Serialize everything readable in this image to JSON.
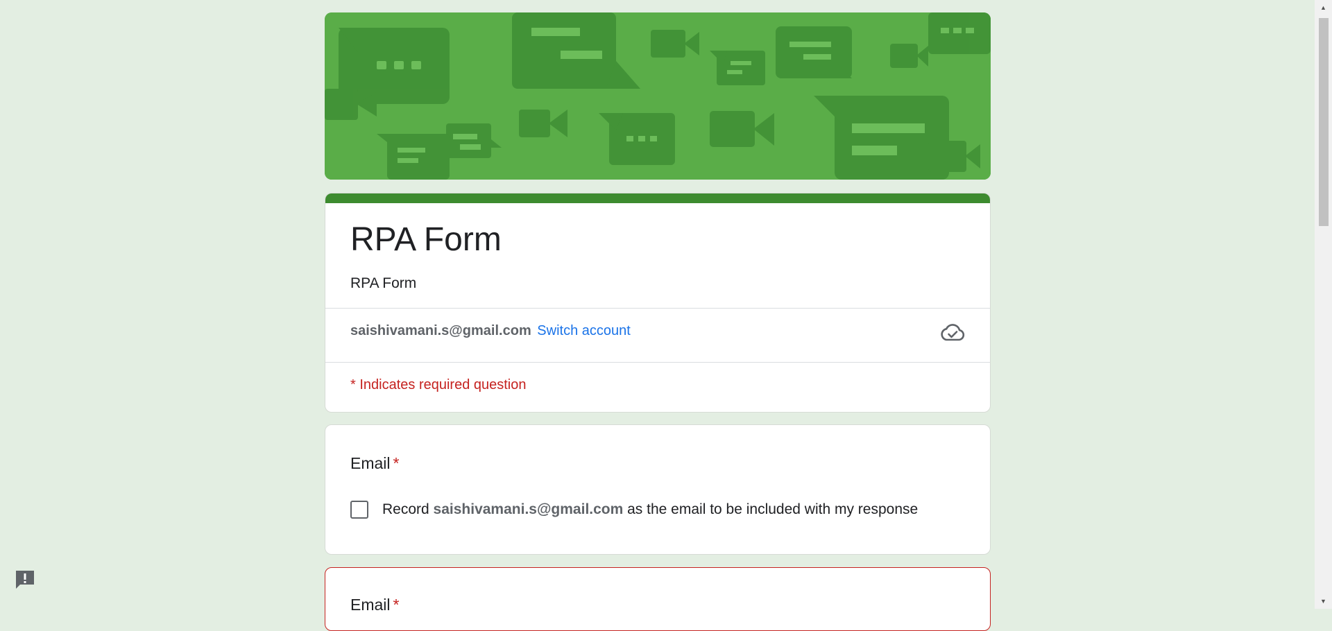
{
  "form": {
    "title": "RPA Form",
    "description": "RPA Form",
    "account_email": "saishivamani.s@gmail.com",
    "switch_account_label": "Switch account",
    "required_note": "* Indicates required question"
  },
  "questions": [
    {
      "label": "Email",
      "required_star": "*",
      "checkbox_prefix": "Record ",
      "checkbox_email": "saishivamani.s@gmail.com",
      "checkbox_suffix": " as the email to be included with my response"
    },
    {
      "label": "Email",
      "required_star": "*"
    }
  ],
  "colors": {
    "background": "#e3eee2",
    "banner": "#5aad48",
    "accent": "#3d8b2f",
    "required": "#c5221f",
    "link": "#1a73e8"
  },
  "icons": {
    "cloud": "cloud-check-icon",
    "feedback": "feedback-icon"
  }
}
